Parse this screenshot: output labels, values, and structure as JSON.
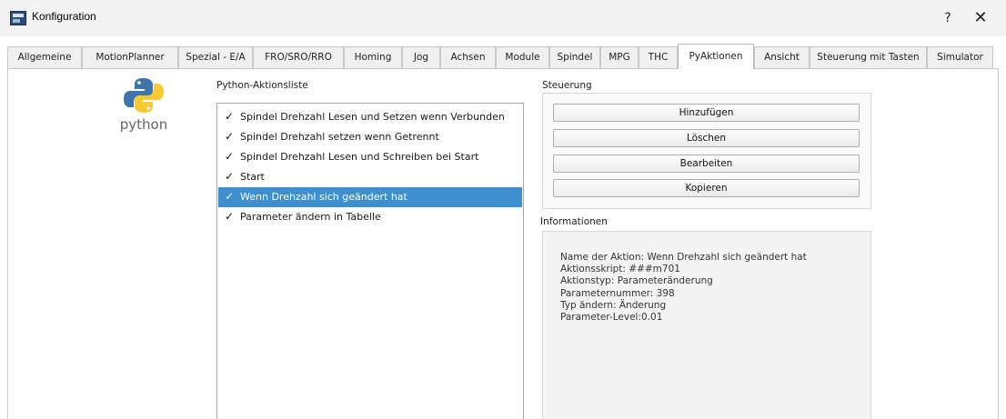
{
  "window": {
    "title": "Konfiguration",
    "help_label": "?",
    "close_label": "✕"
  },
  "tabs": [
    {
      "label": "Allgemeine"
    },
    {
      "label": "MotionPlanner"
    },
    {
      "label": "Spezial - E/A"
    },
    {
      "label": "FRO/SRO/RRO"
    },
    {
      "label": "Homing"
    },
    {
      "label": "Jog"
    },
    {
      "label": "Achsen"
    },
    {
      "label": "Module"
    },
    {
      "label": "Spindel"
    },
    {
      "label": "MPG"
    },
    {
      "label": "THC"
    },
    {
      "label": "PyAktionen"
    },
    {
      "label": "Ansicht"
    },
    {
      "label": "Steuerung mit Tasten"
    },
    {
      "label": "Simulator"
    }
  ],
  "active_tab": "PyAktionen",
  "logo": {
    "word": "python",
    "blue": "#3e74a8",
    "yellow": "#f6c935"
  },
  "action_list": {
    "title": "Python-Aktionsliste",
    "items": [
      {
        "label": "Spindel Drehzahl Lesen und Setzen wenn Verbunden",
        "checked": true
      },
      {
        "label": "Spindel Drehzahl setzen wenn Getrennt",
        "checked": true
      },
      {
        "label": "Spindel Drehzahl Lesen und Schreiben bei Start",
        "checked": true
      },
      {
        "label": "Start",
        "checked": true
      },
      {
        "label": "Wenn Drehzahl sich geändert hat",
        "checked": true,
        "selected": true
      },
      {
        "label": "Parameter ändern in Tabelle",
        "checked": true
      }
    ],
    "check_glyph": "✓",
    "selection_color": "#3d8fcf"
  },
  "controls": {
    "title": "Steuerung",
    "add": "Hinzufügen",
    "delete": "Löschen",
    "edit": "Bearbeiten",
    "copy": "Kopieren"
  },
  "info": {
    "title": "Informationen",
    "lines": [
      "Name der Aktion: Wenn Drehzahl sich geändert hat",
      "Aktionsskript: ###m701",
      "Aktionstyp: Parameteränderung",
      "Parameternummer: 398",
      "Typ ändern: Änderung",
      "Parameter-Level:0.01"
    ]
  }
}
